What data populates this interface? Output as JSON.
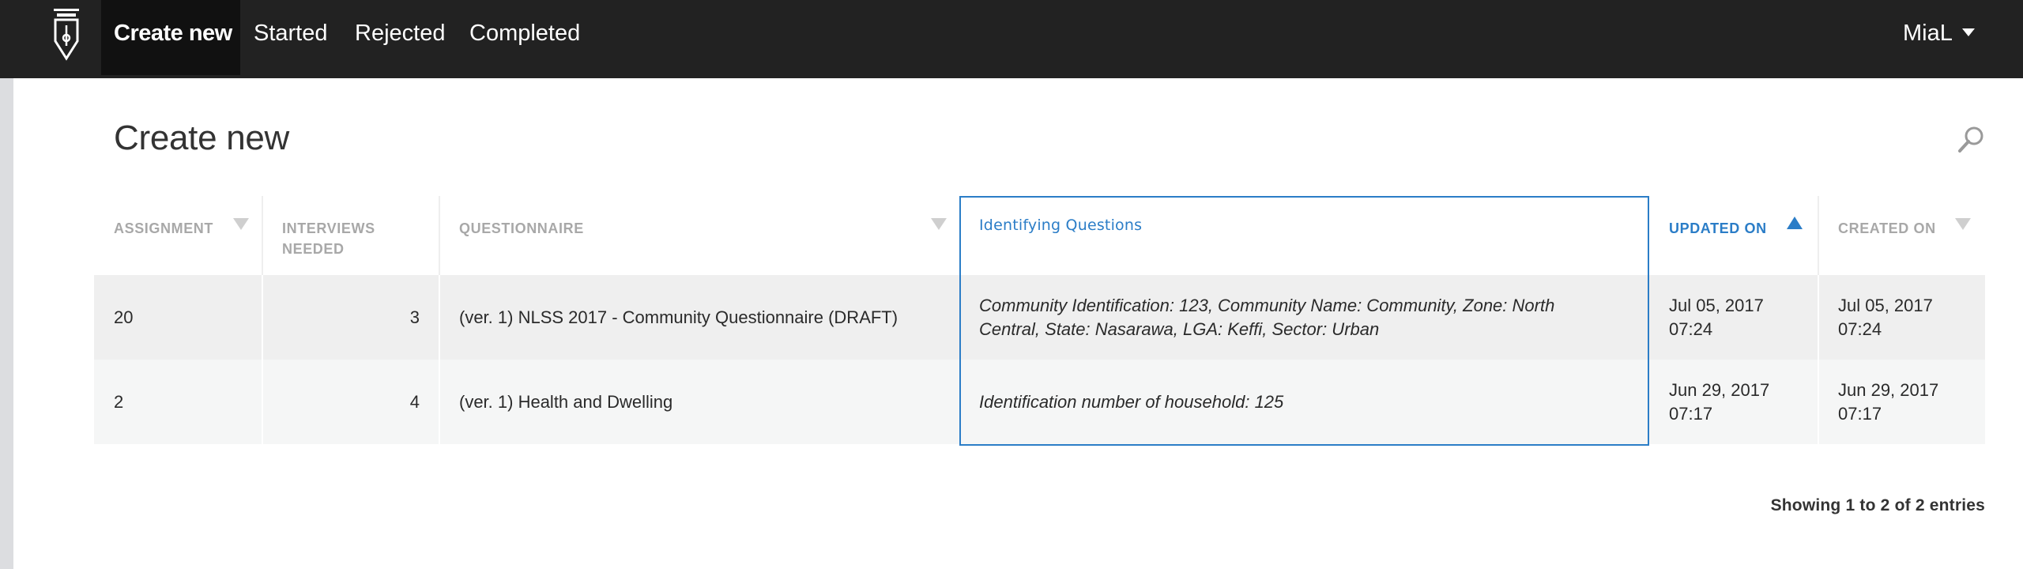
{
  "navbar": {
    "logo_icon": "pen-nib-logo-icon",
    "items": [
      {
        "label": "Create new",
        "active": true
      },
      {
        "label": "Started",
        "active": false
      },
      {
        "label": "Rejected",
        "active": false
      },
      {
        "label": "Completed",
        "active": false
      }
    ],
    "user": {
      "name": "MiaL",
      "icon": "caret-down-icon"
    }
  },
  "page": {
    "title": "Create new",
    "search_icon": "search-icon"
  },
  "table": {
    "columns": [
      {
        "label": "ASSIGNMENT",
        "sort": "unsorted"
      },
      {
        "label": "INTERVIEWS NEEDED",
        "sort": "none"
      },
      {
        "label": "QUESTIONNAIRE",
        "sort": "unsorted"
      },
      {
        "label": "Identifying Questions",
        "sort": "none",
        "highlighted": true
      },
      {
        "label": "UPDATED ON",
        "sort": "ascending"
      },
      {
        "label": "CREATED ON",
        "sort": "unsorted"
      }
    ],
    "rows": [
      {
        "assignment": "20",
        "interviews_needed": "3",
        "questionnaire": "(ver. 1) NLSS 2017 - Community Questionnaire (DRAFT)",
        "identifying_questions": "Community Identification: 123, Community Name: Community, Zone: North Central, State: Nasarawa, LGA: Keffi, Sector: Urban",
        "updated_on": "Jul 05, 2017 07:24",
        "created_on": "Jul 05, 2017 07:24"
      },
      {
        "assignment": "2",
        "interviews_needed": "4",
        "questionnaire": "(ver. 1) Health and Dwelling",
        "identifying_questions": "Identification number of household: 125",
        "updated_on": "Jun 29, 2017 07:17",
        "created_on": "Jun 29, 2017 07:17"
      }
    ]
  },
  "footer": {
    "info": "Showing 1 to 2 of 2 entries"
  },
  "colors": {
    "navbar_bg": "#222222",
    "active_tab_bg": "#111111",
    "accent": "#2b7dc7",
    "header_text": "#a8a8a8",
    "row_bg": "#efefef"
  }
}
